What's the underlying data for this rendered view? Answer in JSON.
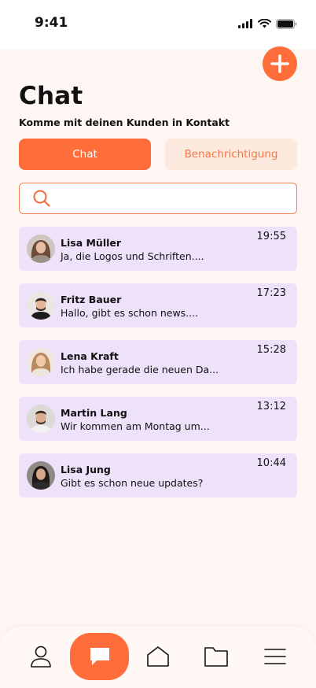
{
  "status_bar": {
    "time": "9:41",
    "icons": [
      "signal-icon",
      "wifi-icon",
      "battery-icon"
    ]
  },
  "header": {
    "title": "Chat",
    "subtitle": "Komme mit deinen Kunden in Kontakt",
    "add_icon": "plus-icon"
  },
  "tabs": [
    {
      "label": "Chat",
      "active": true
    },
    {
      "label": "Benachrichtigung",
      "active": false
    }
  ],
  "search": {
    "placeholder": "",
    "value": "",
    "icon": "search-icon"
  },
  "chats": [
    {
      "name": "Lisa Müller",
      "message": "Ja, die Logos und Schriften....",
      "time": "19:55",
      "avatar": "avatar-lisa-mueller"
    },
    {
      "name": "Fritz Bauer",
      "message": "Hallo, gibt es schon news....",
      "time": "17:23",
      "avatar": "avatar-fritz-bauer"
    },
    {
      "name": "Lena Kraft",
      "message": "Ich habe gerade die neuen Da...",
      "time": "15:28",
      "avatar": "avatar-lena-kraft"
    },
    {
      "name": "Martin Lang",
      "message": "Wir kommen am Montag um...",
      "time": "13:12",
      "avatar": "avatar-martin-lang"
    },
    {
      "name": "Lisa Jung",
      "message": "Gibt es schon neue updates?",
      "time": "10:44",
      "avatar": "avatar-lisa-jung"
    }
  ],
  "bottom_nav": {
    "items": [
      "profile-icon",
      "chat-icon",
      "home-icon",
      "folder-icon",
      "menu-icon"
    ],
    "active": "chat-icon"
  },
  "colors": {
    "accent": "#FF6D3A",
    "background": "#FEF6F3",
    "chat_item": "#EEE2FA",
    "tab_inactive": "#FDE9DD"
  }
}
